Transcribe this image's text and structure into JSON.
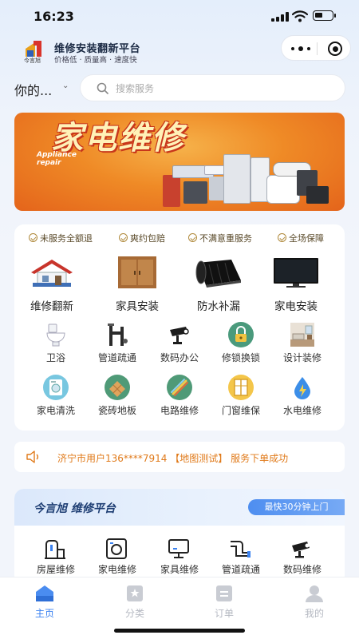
{
  "status": {
    "time": "16:23"
  },
  "header": {
    "logo_text": "今言旭",
    "title": "维修安装翻新平台",
    "slogan": "价格低 · 质量高 · 速度快"
  },
  "location": {
    "label": "你的...",
    "caret_icon": "chevron-down-icon"
  },
  "search": {
    "placeholder": "搜索服务",
    "icon": "search-icon"
  },
  "banner": {
    "title": "家电维修",
    "subtitle": "Appliance repair",
    "colors": {
      "bg": "#ef8a26",
      "title": "#fff2b8"
    }
  },
  "guarantees": [
    "未服务全额退",
    "爽约包赔",
    "不满意重服务",
    "全场保障"
  ],
  "big_services": [
    {
      "label": "维修翻新",
      "icon": "house-repair-icon"
    },
    {
      "label": "家具安装",
      "icon": "cabinet-icon"
    },
    {
      "label": "防水补漏",
      "icon": "waterproof-roll-icon"
    },
    {
      "label": "家电安装",
      "icon": "tv-icon"
    }
  ],
  "small_services_row1": [
    {
      "label": "卫浴",
      "icon": "toilet-icon"
    },
    {
      "label": "管道疏通",
      "icon": "pipe-icon"
    },
    {
      "label": "数码办公",
      "icon": "camera-icon"
    },
    {
      "label": "修锁换锁",
      "icon": "lock-icon"
    },
    {
      "label": "设计装修",
      "icon": "interior-icon"
    }
  ],
  "small_services_row2": [
    {
      "label": "家电清洗",
      "icon": "washing-machine-icon"
    },
    {
      "label": "瓷砖地板",
      "icon": "tile-icon"
    },
    {
      "label": "电路维修",
      "icon": "circuit-icon"
    },
    {
      "label": "门窗维保",
      "icon": "window-icon"
    },
    {
      "label": "水电维修",
      "icon": "water-electric-icon"
    }
  ],
  "notice": {
    "text": "济宁市用户136****7914 【地图测试】 服务下单成功",
    "icon": "speaker-icon"
  },
  "platform": {
    "title": "今言旭 维修平台",
    "tag": "最快30分钟上门",
    "items": [
      {
        "label": "房屋维修",
        "icon": "house-icon"
      },
      {
        "label": "家电维修",
        "icon": "washer-icon"
      },
      {
        "label": "家具维修",
        "icon": "monitor-icon"
      },
      {
        "label": "管道疏通",
        "icon": "pipe-icon"
      },
      {
        "label": "数码维修",
        "icon": "camera-icon"
      }
    ]
  },
  "tabs": [
    {
      "label": "主页",
      "icon": "home-icon",
      "active": true
    },
    {
      "label": "分类",
      "icon": "category-icon",
      "active": false
    },
    {
      "label": "订单",
      "icon": "order-icon",
      "active": false
    },
    {
      "label": "我的",
      "icon": "user-icon",
      "active": false
    }
  ],
  "colors": {
    "accent": "#3b82f0",
    "notice": "#e07a1a",
    "guarantee": "#b08a3c"
  }
}
